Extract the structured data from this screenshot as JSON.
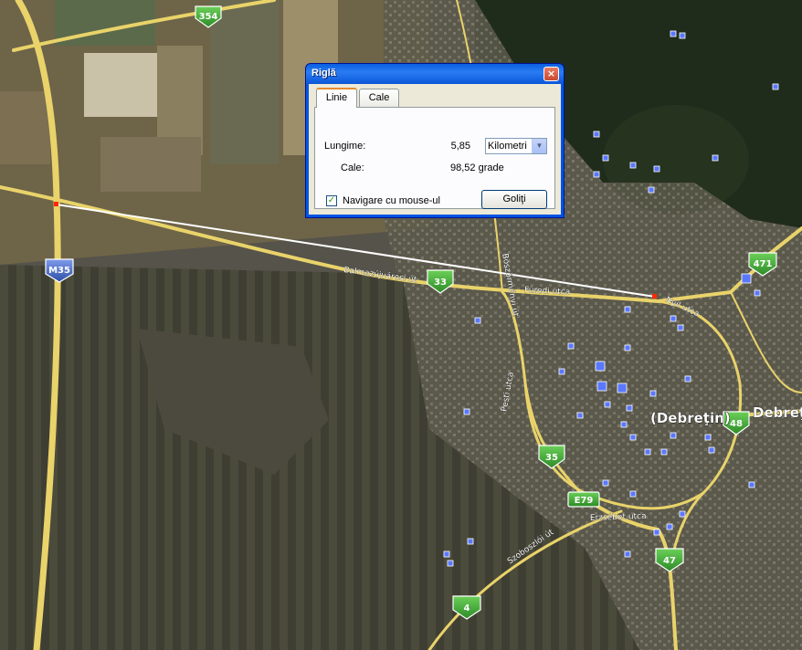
{
  "dialog": {
    "title": "Riglă",
    "close_glyph": "×",
    "tabs": [
      "Linie",
      "Cale"
    ],
    "active_tab": "Linie",
    "length_label": "Lungime:",
    "length_value": "5,85",
    "unit_selected": "Kilometri",
    "heading_label": "Cale:",
    "heading_value": "98,52 grade",
    "mouse_nav_label": "Navigare cu mouse-ul",
    "mouse_nav_checked": true,
    "clear_button": "Goliţi"
  },
  "map": {
    "road_shields": {
      "r354": "354",
      "r471": "471",
      "m35": "M35",
      "r33": "33",
      "r48": "48",
      "r35": "35",
      "e79": "E79",
      "r47": "47",
      "r4": "4"
    },
    "street_labels": {
      "balmazujvarosi": "Balmazújvárosi út",
      "furedi": "Füredi utca",
      "bosztormenyi": "Böszörményi út",
      "pesti": "Pesti utca",
      "nyil": "Nyíl utca",
      "erzsebet": "Erzsébet utca",
      "szoboszloi": "Szoboszlói út"
    },
    "city_labels": {
      "debretin": "(Debreţin)",
      "debrecen": "Debreţ"
    },
    "colors": {
      "road": "#e9d36a",
      "shield": "#3fa535",
      "shield_blue": "#3a5fb8",
      "ruler_line": "#ffffff",
      "marker": "#ff2a00",
      "poi": "#5a78ff"
    }
  }
}
